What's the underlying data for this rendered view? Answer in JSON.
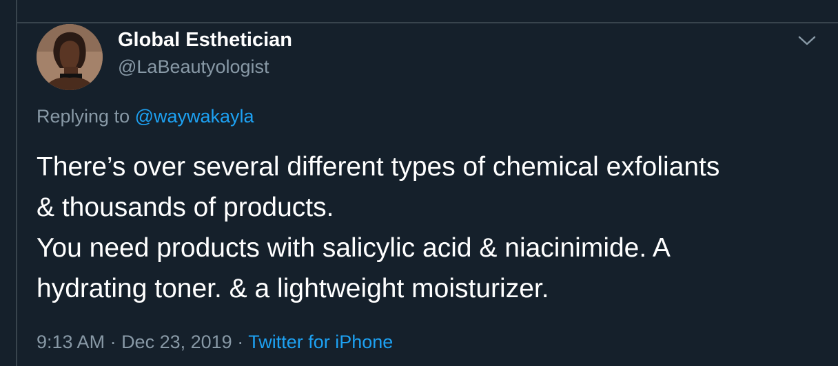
{
  "author": {
    "display_name": "Global Esthetician",
    "handle": "@LaBeautyologist",
    "avatar_icon": "profile-photo"
  },
  "reply": {
    "prefix": "Replying to ",
    "to_handle": "@waywakayla"
  },
  "tweet": {
    "lines": [
      "There’s over several different types of chemical exfoliants",
      "& thousands of products.",
      "You need products with salicylic acid & niacinimide. A",
      "hydrating toner. & a lightweight moisturizer."
    ]
  },
  "meta": {
    "time": "9:13 AM",
    "separator_1": " · ",
    "date": "Dec 23, 2019",
    "separator_2": " · ",
    "source": "Twitter for iPhone"
  },
  "icons": {
    "menu": "chevron-down-icon"
  },
  "colors": {
    "background": "#15202b",
    "primary_text": "#ffffff",
    "secondary_text": "#8899a6",
    "link": "#1da1f2",
    "border": "#38444d"
  }
}
